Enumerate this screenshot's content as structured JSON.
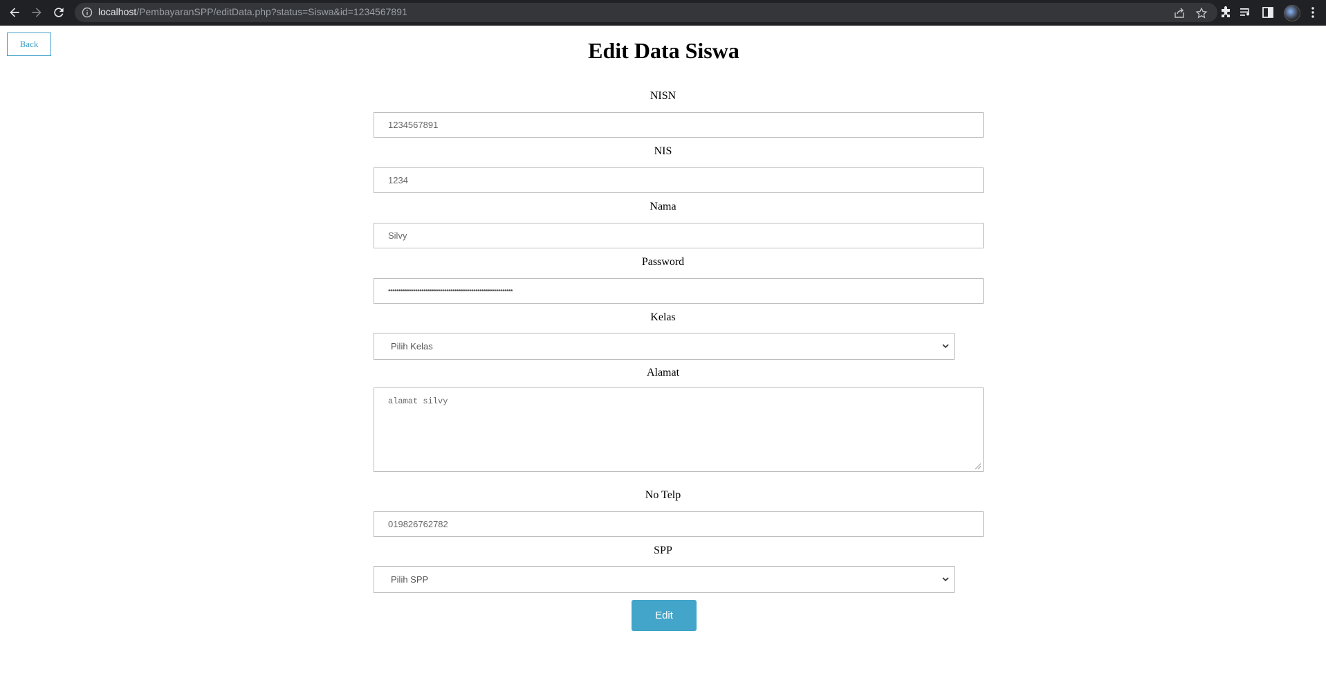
{
  "browser": {
    "url_host": "localhost",
    "url_path": "/PembayaranSPP/editData.php?status=Siswa&id=1234567891"
  },
  "page": {
    "back_label": "Back",
    "title": "Edit Data Siswa",
    "edit_label": "Edit"
  },
  "form": {
    "nisn": {
      "label": "NISN",
      "value": "1234567891"
    },
    "nis": {
      "label": "NIS",
      "value": "1234"
    },
    "nama": {
      "label": "Nama",
      "value": "Silvy"
    },
    "password": {
      "label": "Password",
      "value": "••••••••••••••••••••••••••••••••••••••••••••••••••••••••••••"
    },
    "kelas": {
      "label": "Kelas",
      "selected": "Pilih Kelas"
    },
    "alamat": {
      "label": "Alamat",
      "value": "alamat silvy"
    },
    "no_telp": {
      "label": "No Telp",
      "value": "019826762782"
    },
    "spp": {
      "label": "SPP",
      "selected": "Pilih SPP"
    }
  },
  "colors": {
    "accent": "#42a5c9",
    "chrome_bg": "#202124"
  }
}
